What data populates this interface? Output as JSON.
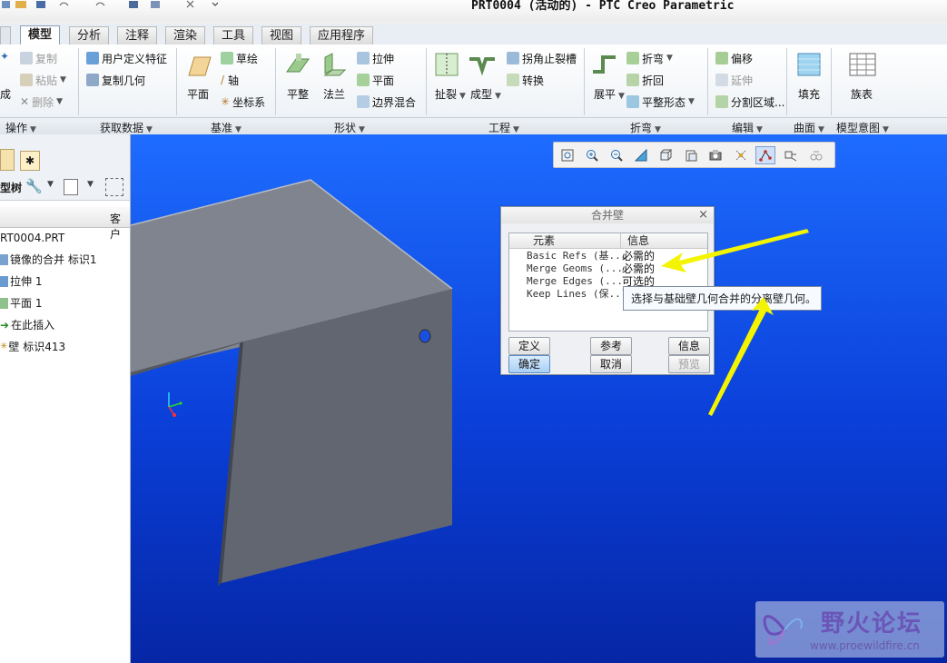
{
  "window": {
    "title": "PRT0004 (活动的) - PTC Creo Parametric"
  },
  "tabs": [
    {
      "label": "模型",
      "active": true
    },
    {
      "label": "分析"
    },
    {
      "label": "注释"
    },
    {
      "label": "渲染"
    },
    {
      "label": "工具"
    },
    {
      "label": "视图"
    },
    {
      "label": "应用程序"
    }
  ],
  "ribbon": {
    "operations": {
      "copy": "复制",
      "paste": "粘贴",
      "delete": "删除",
      "regen_partial": "成"
    },
    "get_data": {
      "udf": "用户定义特征",
      "copy_geom": "复制几何"
    },
    "datum": {
      "plane": "平面",
      "sketch": "草绘",
      "axis": "轴",
      "csys": "坐标系"
    },
    "shapes": {
      "flat": "平整",
      "flange": "法兰",
      "extrude": "拉伸",
      "plane_wall": "平面",
      "boundary_blend": "边界混合"
    },
    "engineering": {
      "rip": "扯裂",
      "form": "成型",
      "corner_relief": "拐角止裂槽",
      "convert": "转换"
    },
    "bends": {
      "unbend": "展平",
      "bend": "折弯",
      "bend_back": "折回",
      "flat_pattern": "平整形态"
    },
    "editing": {
      "offset": "偏移",
      "extend": "延伸",
      "split_area": "分割区域..."
    },
    "surfaces": {
      "fill": "填充"
    },
    "model_intent": {
      "family_table": "族表"
    }
  },
  "groups": [
    {
      "label": "操作"
    },
    {
      "label": "获取数据"
    },
    {
      "label": "基准"
    },
    {
      "label": "形状"
    },
    {
      "label": "工程"
    },
    {
      "label": "折弯"
    },
    {
      "label": "编辑"
    },
    {
      "label": "曲面"
    },
    {
      "label": "模型意图"
    }
  ],
  "left_panel": {
    "model_tree_label": "型树",
    "column_header": "客户",
    "items": [
      {
        "label": "RT0004.PRT"
      },
      {
        "label": "镜像的合并 标识1"
      },
      {
        "label": "拉伸 1"
      },
      {
        "label": "平面 1"
      },
      {
        "label": "在此插入"
      },
      {
        "label": "壁 标识413"
      }
    ]
  },
  "dialog": {
    "title": "合并壁",
    "columns": {
      "element": "元素",
      "info": "信息"
    },
    "rows": [
      {
        "element": "Basic Refs (基...",
        "info": "必需的"
      },
      {
        "element": "Merge Geoms (...",
        "info": "必需的"
      },
      {
        "element": "Merge Edges (...",
        "info": "可选的"
      },
      {
        "element": "Keep Lines (保...",
        "info": "可"
      }
    ],
    "buttons": {
      "define": "定义",
      "refs": "参考",
      "info": "信息",
      "ok": "确定",
      "cancel": "取消",
      "preview": "预览"
    },
    "tooltip": "选择与基础壁几何合并的分离壁几何。"
  },
  "watermark": {
    "title": "野火论坛",
    "url": "www.proewildfire.cn"
  },
  "colors": {
    "viewport_top": "#1e6cff",
    "viewport_bottom": "#0626a5",
    "arrow": "#f4f400",
    "part": "#6e737c"
  }
}
